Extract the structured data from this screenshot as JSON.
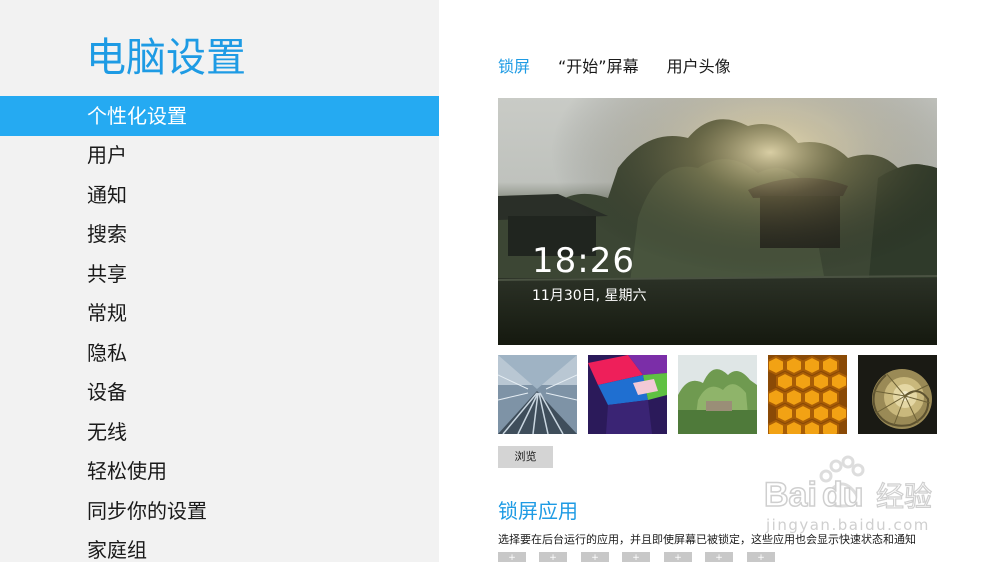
{
  "nav": {
    "title": "电脑设置",
    "items": [
      {
        "label": "个性化设置",
        "selected": true
      },
      {
        "label": "用户"
      },
      {
        "label": "通知"
      },
      {
        "label": "搜索"
      },
      {
        "label": "共享"
      },
      {
        "label": "常规"
      },
      {
        "label": "隐私"
      },
      {
        "label": "设备"
      },
      {
        "label": "无线"
      },
      {
        "label": "轻松使用"
      },
      {
        "label": "同步你的设置"
      },
      {
        "label": "家庭组"
      }
    ]
  },
  "tabs": [
    {
      "label": "锁屏",
      "active": true
    },
    {
      "label": "“开始”屏幕"
    },
    {
      "label": "用户头像"
    }
  ],
  "lockscreen_preview": {
    "time": "18:26",
    "date": "11月30日, 星期六"
  },
  "thumbnails": [
    {
      "name": "tunnel-rails-image"
    },
    {
      "name": "geometric-shapes-image"
    },
    {
      "name": "garden-trees-image"
    },
    {
      "name": "honeycomb-image"
    },
    {
      "name": "nautilus-shell-image"
    }
  ],
  "browse_button": "浏览",
  "lock_apps": {
    "title": "锁屏应用",
    "description": "选择要在后台运行的应用，并且即使屏幕已被锁定，这些应用也会显示快速状态和通知",
    "slots": [
      "+",
      "+",
      "+",
      "+",
      "+",
      "+",
      "+"
    ]
  },
  "watermark": {
    "brand": "Baidu经验",
    "url": "jingyan.baidu.com"
  },
  "colors": {
    "accent": "#1e9be4",
    "selected_bg": "#25aaf2",
    "nav_bg": "#f2f2f2"
  }
}
